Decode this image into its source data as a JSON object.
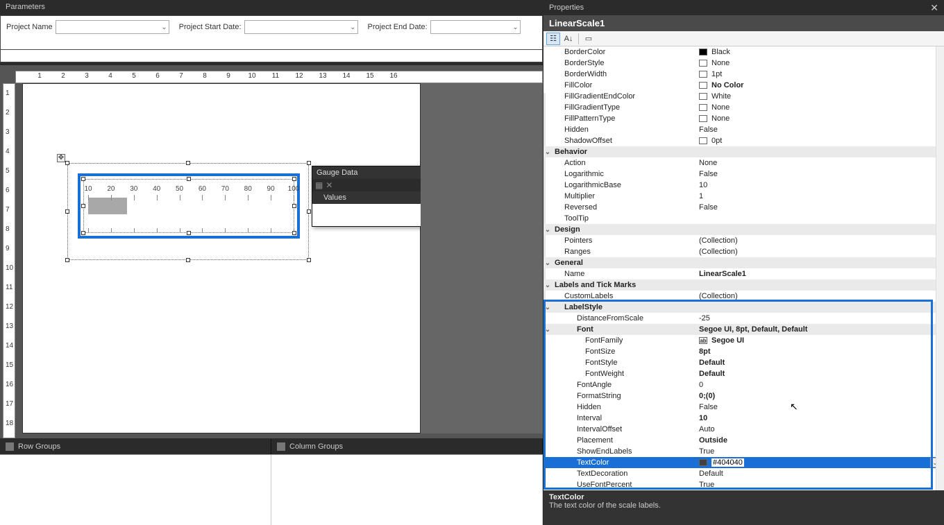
{
  "parameters": {
    "title": "Parameters",
    "fields": [
      {
        "label": "Project Name"
      },
      {
        "label": "Project Start Date:"
      },
      {
        "label": "Project End Date:"
      }
    ]
  },
  "ruler_h": [
    "1",
    "2",
    "3",
    "4",
    "5",
    "6",
    "7",
    "8",
    "9",
    "10",
    "11",
    "12",
    "13",
    "14",
    "15",
    "16"
  ],
  "ruler_v": [
    "1",
    "2",
    "3",
    "4",
    "5",
    "6",
    "7",
    "8",
    "9",
    "10",
    "11",
    "12",
    "13",
    "14",
    "15",
    "16",
    "17",
    "18"
  ],
  "gauge": {
    "scale_labels": [
      "10",
      "20",
      "30",
      "40",
      "50",
      "60",
      "70",
      "80",
      "90",
      "100"
    ]
  },
  "gauge_data": {
    "title": "Gauge Data",
    "section": "Values"
  },
  "groups": {
    "row": "Row Groups",
    "column": "Column Groups"
  },
  "properties": {
    "title": "Properties",
    "object": "LinearScale1",
    "rows": [
      {
        "type": "prop",
        "label": "BorderColor",
        "value": "Black",
        "swatch": "black",
        "level": 1
      },
      {
        "type": "prop",
        "label": "BorderStyle",
        "value": "None",
        "swatch": "none",
        "level": 1
      },
      {
        "type": "prop",
        "label": "BorderWidth",
        "value": "1pt",
        "swatch": "none",
        "level": 1
      },
      {
        "type": "prop",
        "label": "FillColor",
        "value": "No Color",
        "swatch": "nocolor",
        "level": 1,
        "bold": true
      },
      {
        "type": "prop",
        "label": "FillGradientEndColor",
        "value": "White",
        "swatch": "white",
        "level": 1
      },
      {
        "type": "prop",
        "label": "FillGradientType",
        "value": "None",
        "swatch": "none",
        "level": 1
      },
      {
        "type": "prop",
        "label": "FillPatternType",
        "value": "None",
        "swatch": "none",
        "level": 1
      },
      {
        "type": "prop",
        "label": "Hidden",
        "value": "False",
        "level": 1
      },
      {
        "type": "prop",
        "label": "ShadowOffset",
        "value": "0pt",
        "swatch": "none",
        "level": 1
      },
      {
        "type": "header",
        "label": "Behavior"
      },
      {
        "type": "prop",
        "label": "Action",
        "value": "None",
        "level": 1
      },
      {
        "type": "prop",
        "label": "Logarithmic",
        "value": "False",
        "level": 1
      },
      {
        "type": "prop",
        "label": "LogarithmicBase",
        "value": "10",
        "level": 1
      },
      {
        "type": "prop",
        "label": "Multiplier",
        "value": "1",
        "level": 1
      },
      {
        "type": "prop",
        "label": "Reversed",
        "value": "False",
        "level": 1
      },
      {
        "type": "prop",
        "label": "ToolTip",
        "value": "",
        "level": 1
      },
      {
        "type": "header",
        "label": "Design"
      },
      {
        "type": "prop",
        "label": "Pointers",
        "value": "(Collection)",
        "level": 1
      },
      {
        "type": "prop",
        "label": "Ranges",
        "value": "(Collection)",
        "level": 1
      },
      {
        "type": "header",
        "label": "General"
      },
      {
        "type": "prop",
        "label": "Name",
        "value": "LinearScale1",
        "level": 1,
        "bold": true
      },
      {
        "type": "header",
        "label": "Labels and Tick Marks"
      },
      {
        "type": "prop",
        "label": "CustomLabels",
        "value": "(Collection)",
        "level": 1
      },
      {
        "type": "header2",
        "label": "LabelStyle"
      },
      {
        "type": "prop",
        "label": "DistanceFromScale",
        "value": "-25",
        "level": 2
      },
      {
        "type": "header3",
        "label": "Font",
        "value": "Segoe UI, 8pt, Default, Default",
        "bold": true
      },
      {
        "type": "prop",
        "label": "FontFamily",
        "value": "Segoe UI",
        "fonticon": true,
        "level": 3,
        "bold": true
      },
      {
        "type": "prop",
        "label": "FontSize",
        "value": "8pt",
        "level": 3,
        "bold": true
      },
      {
        "type": "prop",
        "label": "FontStyle",
        "value": "Default",
        "level": 3,
        "bold": true
      },
      {
        "type": "prop",
        "label": "FontWeight",
        "value": "Default",
        "level": 3,
        "bold": true
      },
      {
        "type": "prop",
        "label": "FontAngle",
        "value": "0",
        "level": 2
      },
      {
        "type": "prop",
        "label": "FormatString",
        "value": "0;(0)",
        "level": 2,
        "bold": true
      },
      {
        "type": "prop",
        "label": "Hidden",
        "value": "False",
        "level": 2
      },
      {
        "type": "prop",
        "label": "Interval",
        "value": "10",
        "level": 2,
        "bold": true
      },
      {
        "type": "prop",
        "label": "IntervalOffset",
        "value": "Auto",
        "level": 2
      },
      {
        "type": "prop",
        "label": "Placement",
        "value": "Outside",
        "level": 2,
        "bold": true
      },
      {
        "type": "prop",
        "label": "ShowEndLabels",
        "value": "True",
        "level": 2
      },
      {
        "type": "prop",
        "label": "TextColor",
        "value": "#404040",
        "swatch": "grey",
        "level": 2,
        "selected": true,
        "dropdown": true
      },
      {
        "type": "prop",
        "label": "TextDecoration",
        "value": "Default",
        "level": 2
      },
      {
        "type": "prop",
        "label": "UseFontPercent",
        "value": "True",
        "level": 2
      }
    ],
    "description": {
      "title": "TextColor",
      "text": "The text color of the scale labels."
    }
  }
}
